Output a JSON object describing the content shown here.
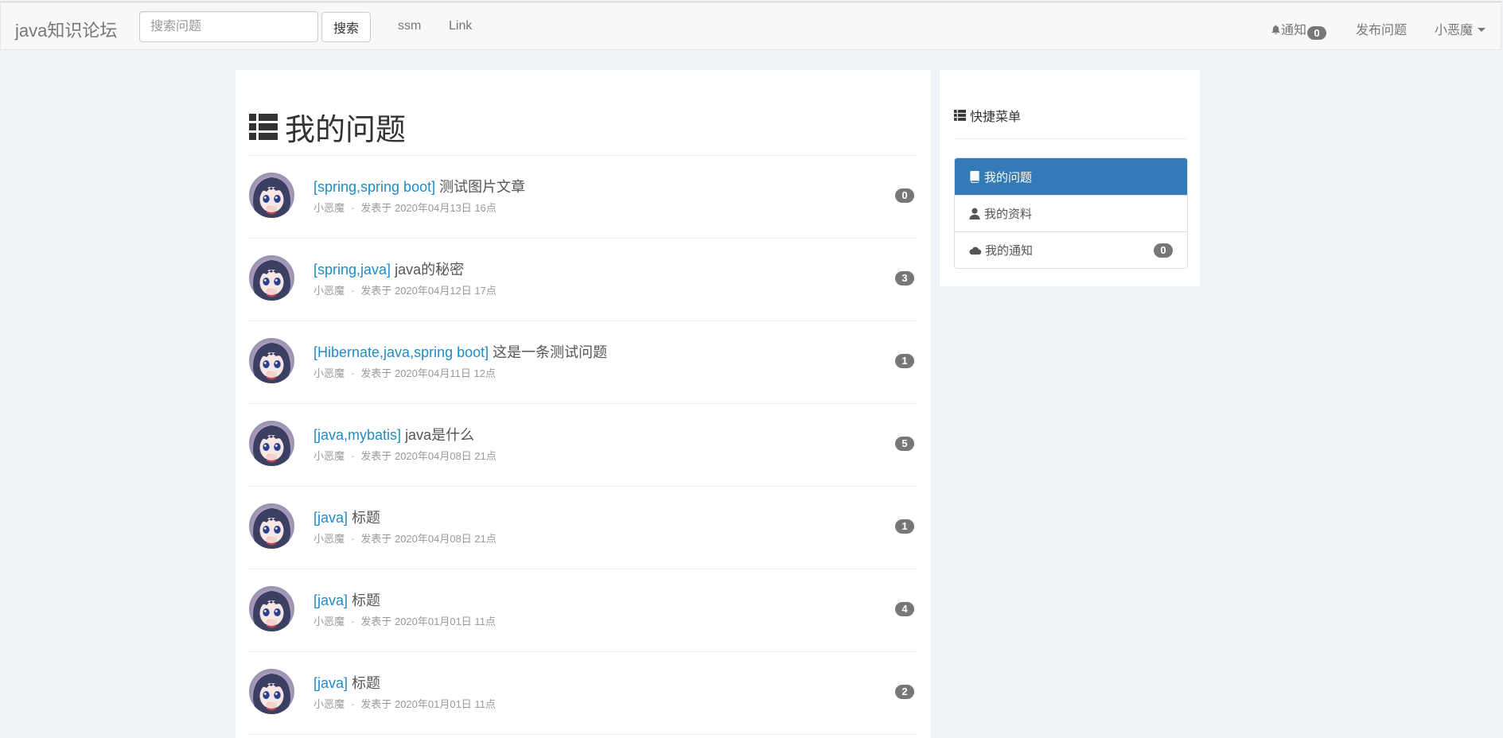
{
  "navbar": {
    "brand": "java知识论坛",
    "search_placeholder": "搜索问题",
    "search_button": "搜索",
    "links": [
      "ssm",
      "Link"
    ],
    "notifications_label": "通知",
    "notifications_count": "0",
    "publish_label": "发布问题",
    "user_name": "小恶魔"
  },
  "main": {
    "title": "我的问题",
    "questions": [
      {
        "tags": "[spring,spring boot]",
        "title": "测试图片文章",
        "author": "小恶魔",
        "separator": "·",
        "date": "发表于 2020年04月13日 16点",
        "count": "0"
      },
      {
        "tags": "[spring,java]",
        "title": "java的秘密",
        "author": "小恶魔",
        "separator": "·",
        "date": "发表于 2020年04月12日 17点",
        "count": "3"
      },
      {
        "tags": "[Hibernate,java,spring boot]",
        "title": "这是一条测试问题",
        "author": "小恶魔",
        "separator": "·",
        "date": "发表于 2020年04月11日 12点",
        "count": "1"
      },
      {
        "tags": "[java,mybatis]",
        "title": "java是什么",
        "author": "小恶魔",
        "separator": "·",
        "date": "发表于 2020年04月08日 21点",
        "count": "5"
      },
      {
        "tags": "[java]",
        "title": "标题",
        "author": "小恶魔",
        "separator": "·",
        "date": "发表于 2020年04月08日 21点",
        "count": "1"
      },
      {
        "tags": "[java]",
        "title": "标题",
        "author": "小恶魔",
        "separator": "·",
        "date": "发表于 2020年01月01日 11点",
        "count": "4"
      },
      {
        "tags": "[java]",
        "title": "标题",
        "author": "小恶魔",
        "separator": "·",
        "date": "发表于 2020年01月01日 11点",
        "count": "2"
      }
    ]
  },
  "sidebar": {
    "title": "快捷菜单",
    "items": [
      {
        "label": "我的问题",
        "icon": "book-icon",
        "active": true
      },
      {
        "label": "我的资料",
        "icon": "user-icon",
        "active": false
      },
      {
        "label": "我的通知",
        "icon": "cloud-icon",
        "active": false,
        "badge": "0"
      }
    ]
  },
  "colors": {
    "page_bg": "#eff2f7",
    "accent": "#337ab7",
    "tag_link": "#1e8cc6",
    "badge": "#777777"
  }
}
